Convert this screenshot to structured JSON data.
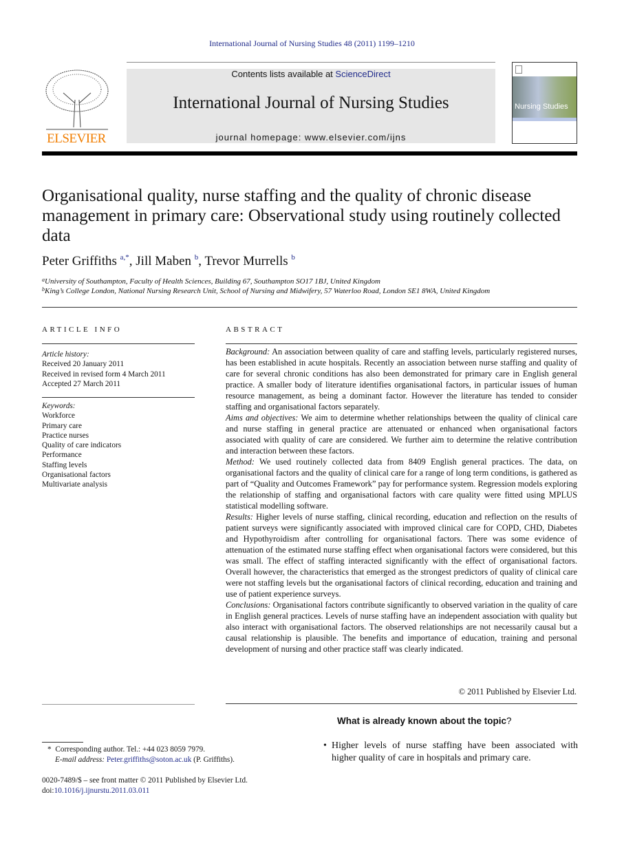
{
  "header": {
    "journal_ref": "International Journal of Nursing Studies 48 (2011) 1199–1210",
    "contents_prefix": "Contents lists available at ",
    "sciencedirect": "ScienceDirect",
    "journal_title": "International Journal of Nursing Studies",
    "homepage": "journal homepage: www.elsevier.com/ijns",
    "publisher_logo": "ELSEVIER",
    "cover_title": "Nursing Studies"
  },
  "article": {
    "title": "Organisational quality, nurse staffing and the quality of chronic disease management in primary care: Observational study using routinely collected data",
    "authors": [
      {
        "name": "Peter Griffiths",
        "sup": "a,*"
      },
      {
        "name": "Jill Maben",
        "sup": "b"
      },
      {
        "name": "Trevor Murrells",
        "sup": "b"
      }
    ],
    "affiliations": [
      {
        "sup": "a",
        "text": "University of Southampton, Faculty of Health Sciences, Building 67, Southampton SO17 1BJ, United Kingdom"
      },
      {
        "sup": "b",
        "text": "King’s College London, National Nursing Research Unit, School of Nursing and Midwifery, 57 Waterloo Road, London SE1 8WA, United Kingdom"
      }
    ]
  },
  "article_info": {
    "heading": "ARTICLE INFO",
    "history_label": "Article history:",
    "history": [
      "Received 20 January 2011",
      "Received in revised form 4 March 2011",
      "Accepted 27 March 2011"
    ],
    "keywords_label": "Keywords:",
    "keywords": [
      "Workforce",
      "Primary care",
      "Practice nurses",
      "Quality of care indicators",
      "Performance",
      "Staffing levels",
      "Organisational factors",
      "Multivariate analysis"
    ]
  },
  "abstract": {
    "heading": "ABSTRACT",
    "sections": [
      {
        "label": "Background:",
        "text": " An association between quality of care and staffing levels, particularly registered nurses, has been established in acute hospitals. Recently an association between nurse staffing and quality of care for several chronic conditions has also been demonstrated for primary care in English general practice. A smaller body of literature identifies organisational factors, in particular issues of human resource management, as being a dominant factor. However the literature has tended to consider staffing and organisational factors separately."
      },
      {
        "label": "Aims and objectives:",
        "text": " We aim to determine whether relationships between the quality of clinical care and nurse staffing in general practice are attenuated or enhanced when organisational factors associated with quality of care are considered. We further aim to determine the relative contribution and interaction between these factors."
      },
      {
        "label": "Method:",
        "text": " We used routinely collected data from 8409 English general practices. The data, on organisational factors and the quality of clinical care for a range of long term conditions, is gathered as part of “Quality and Outcomes Framework” pay for performance system. Regression models exploring the relationship of staffing and organisational factors with care quality were fitted using MPLUS statistical modelling software."
      },
      {
        "label": "Results:",
        "text": " Higher levels of nurse staffing, clinical recording, education and reflection on the results of patient surveys were significantly associated with improved clinical care for COPD, CHD, Diabetes and Hypothyroidism after controlling for organisational factors. There was some evidence of attenuation of the estimated nurse staffing effect when organisational factors were considered, but this was small. The effect of staffing interacted significantly with the effect of organisational factors. Overall however, the characteristics that emerged as the strongest predictors of quality of clinical care were not staffing levels but the organisational factors of clinical recording, education and training and use of patient experience surveys."
      },
      {
        "label": "Conclusions:",
        "text": " Organisational factors contribute significantly to observed variation in the quality of care in English general practices. Levels of nurse staffing have an independent association with quality but also interact with organisational factors. The observed relationships are not necessarily causal but a causal relationship is plausible. The benefits and importance of education, training and personal development of nursing and other practice staff was clearly indicated."
      }
    ],
    "copyright": "© 2011 Published by Elsevier Ltd."
  },
  "known": {
    "heading": "What is already known about the topic",
    "qmark": "?",
    "bullets": [
      "Higher levels of nurse staffing have been associated with higher quality of care in hospitals and primary care."
    ]
  },
  "footnotes": {
    "star": "*",
    "corresponding": "Corresponding author. Tel.: +44 023 8059 7979.",
    "email_label": "E-mail address:",
    "email": "Peter.griffiths@soton.ac.uk",
    "email_suffix": " (P. Griffiths).",
    "front_matter": "0020-7489/$ – see front matter © 2011 Published by Elsevier Ltd.",
    "doi_label": "doi:",
    "doi": "10.1016/j.ijnurstu.2011.03.011"
  }
}
